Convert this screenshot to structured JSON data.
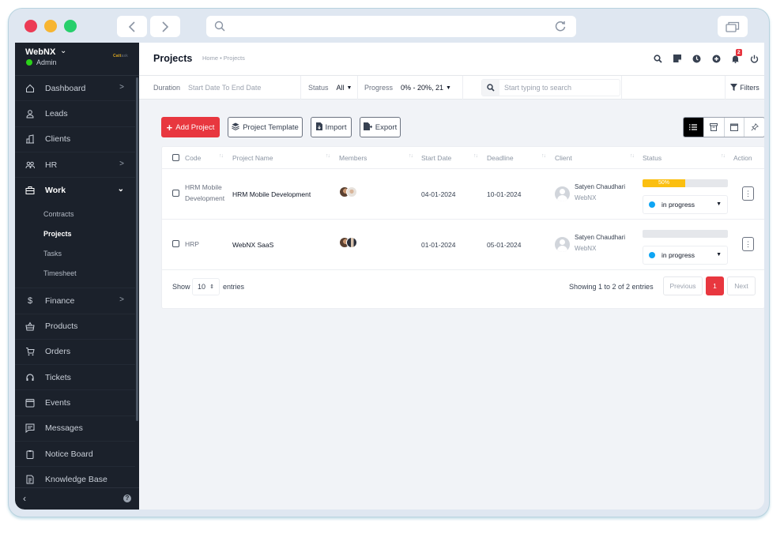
{
  "browser": {
    "back_icon": "chevron-left-icon",
    "forward_icon": "chevron-right-icon",
    "url": "",
    "search_icon": "search-icon",
    "reload_icon": "reload-icon",
    "tabs_icon": "tabs-icon"
  },
  "brand": {
    "name": "WebNX",
    "role": "Admin",
    "status_color": "#2bd219",
    "logo_text_a": "Catt",
    "logo_text_b": "ask"
  },
  "sidebar": {
    "items": [
      {
        "label": "Dashboard",
        "icon": "home-icon",
        "has_chevron": true
      },
      {
        "label": "Leads",
        "icon": "user-icon",
        "has_chevron": false
      },
      {
        "label": "Clients",
        "icon": "building-icon",
        "has_chevron": false
      },
      {
        "label": "HR",
        "icon": "users-icon",
        "has_chevron": true
      },
      {
        "label": "Work",
        "icon": "briefcase-icon",
        "has_chevron": true,
        "expanded": true
      },
      {
        "label": "Finance",
        "icon": "dollar-icon",
        "has_chevron": true
      },
      {
        "label": "Products",
        "icon": "basket-icon",
        "has_chevron": false
      },
      {
        "label": "Orders",
        "icon": "cart-icon",
        "has_chevron": false
      },
      {
        "label": "Tickets",
        "icon": "headset-icon",
        "has_chevron": false
      },
      {
        "label": "Events",
        "icon": "calendar-icon",
        "has_chevron": false
      },
      {
        "label": "Messages",
        "icon": "message-icon",
        "has_chevron": false
      },
      {
        "label": "Notice Board",
        "icon": "clipboard-icon",
        "has_chevron": false
      },
      {
        "label": "Knowledge Base",
        "icon": "document-icon",
        "has_chevron": false
      }
    ],
    "work_sub": [
      "Contracts",
      "Projects",
      "Tasks",
      "Timesheet"
    ],
    "active_sub": "Projects"
  },
  "header": {
    "title": "Projects",
    "breadcrumb": "Home • Projects",
    "notification_count": "2"
  },
  "filters": {
    "duration_label": "Duration",
    "duration_value": "Start Date To End Date",
    "status_label": "Status",
    "status_value": "All",
    "progress_label": "Progress",
    "progress_value": "0% - 20%, 21",
    "search_placeholder": "Start typing to search",
    "filters_label": "Filters"
  },
  "toolbar": {
    "add_label": "Add Project",
    "template_label": "Project Template",
    "import_label": "Import",
    "export_label": "Export"
  },
  "table": {
    "columns": [
      "Code",
      "Project Name",
      "Members",
      "Start Date",
      "Deadline",
      "Client",
      "Status",
      "Action"
    ],
    "rows": [
      {
        "code_line1": "HRM Mobile",
        "code_line2": "Development",
        "name": "HRM Mobile Development",
        "start": "04-01-2024",
        "deadline": "10-01-2024",
        "client_name": "Satyen Chaudhari",
        "client_company": "WebNX",
        "progress": 50,
        "progress_label": "50%",
        "status": "in progress"
      },
      {
        "code_line1": "HRP",
        "code_line2": "",
        "name": "WebNX SaaS",
        "start": "01-01-2024",
        "deadline": "05-01-2024",
        "client_name": "Satyen Chaudhari",
        "client_company": "WebNX",
        "progress": 0,
        "progress_label": "",
        "status": "in progress"
      }
    ],
    "show_label": "Show",
    "page_length": "10",
    "entries_label": "entries",
    "info": "Showing 1 to 2 of 2 entries",
    "prev_label": "Previous",
    "current_page": "1",
    "next_label": "Next"
  },
  "colors": {
    "accent": "#e8373f",
    "sidebar_bg": "#1b212b",
    "progress": "#fbbf10",
    "status_dot": "#0ea5f4"
  }
}
